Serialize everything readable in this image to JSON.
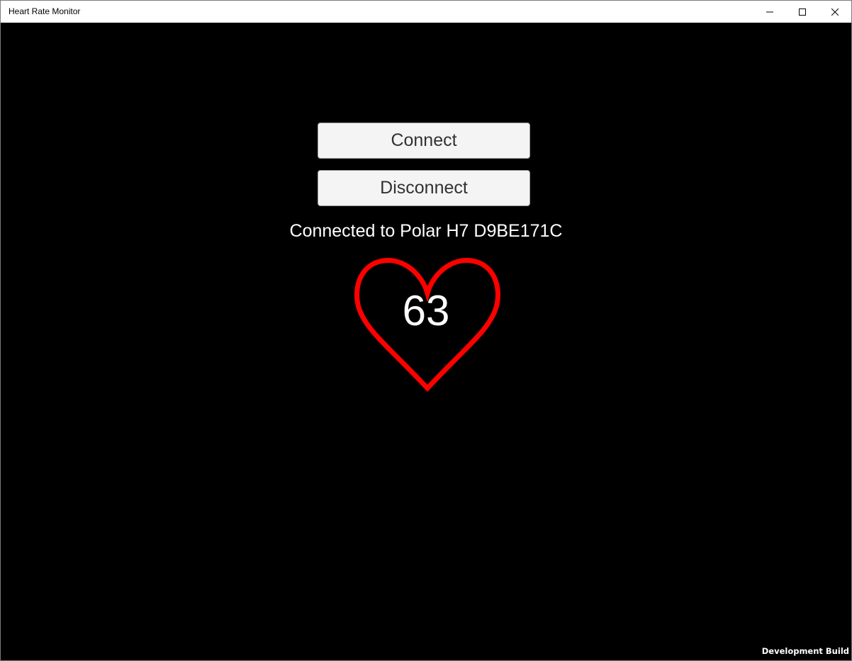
{
  "window": {
    "title": "Heart Rate Monitor",
    "controls": [
      "minimize-icon",
      "maximize-icon",
      "close-icon"
    ]
  },
  "app": {
    "connect_label": "Connect",
    "disconnect_label": "Disconnect",
    "status_text": "Connected to Polar H7 D9BE171C",
    "heart_rate": "63",
    "heart_icon": "heart-icon",
    "heart_color": "#ff0000",
    "background_color": "#000000"
  },
  "footer": {
    "build_label": "Development Build"
  }
}
